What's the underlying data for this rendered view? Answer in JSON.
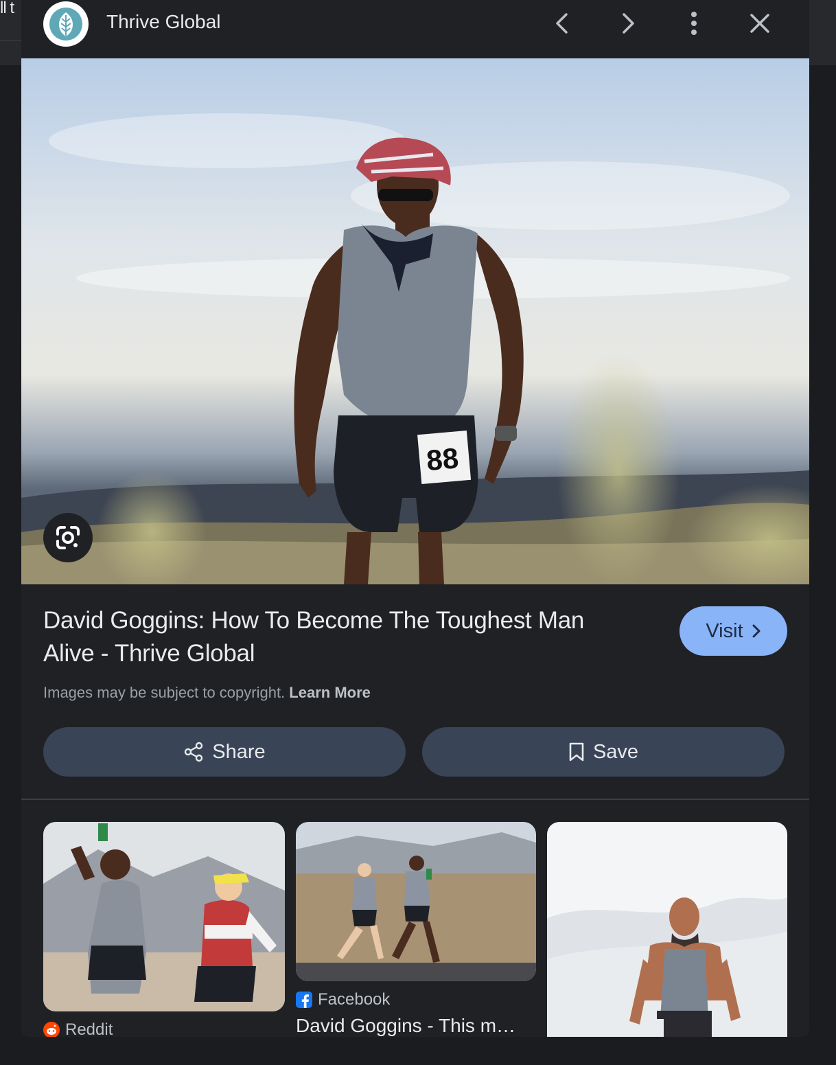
{
  "background_page": {
    "partial_text": "ll t"
  },
  "header": {
    "site_name": "Thrive Global",
    "prev_label": "Previous",
    "next_label": "Next",
    "more_label": "More options",
    "close_label": "Close"
  },
  "result": {
    "title": "David Goggins: How To Become The Toughest Man Alive - Thrive Global",
    "visit_label": "Visit",
    "copyright_text": "Images may be subject to copyright.",
    "learn_more": "Learn More",
    "bib_number": "88"
  },
  "actions": {
    "share_label": "Share",
    "save_label": "Save"
  },
  "related": [
    {
      "source": "Reddit",
      "caption": ""
    },
    {
      "source": "Facebook",
      "caption": "David Goggins - This m…"
    },
    {
      "source": "",
      "caption": ""
    }
  ],
  "colors": {
    "accent": "#8ab4f8",
    "panel": "#1f2125",
    "button": "#394457",
    "brand_teal": "#5fa8b8"
  }
}
